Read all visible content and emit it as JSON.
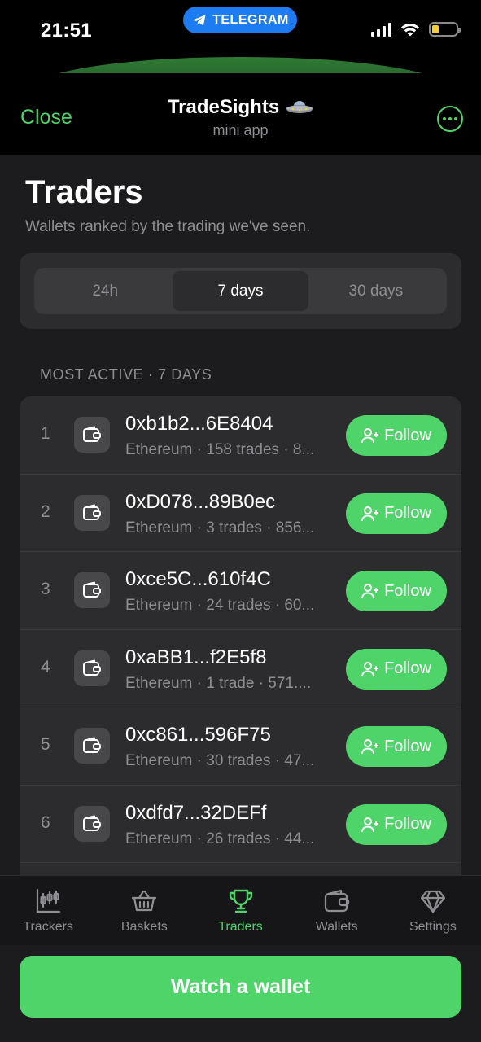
{
  "status_bar": {
    "time": "21:51",
    "telegram_label": "TELEGRAM",
    "battery_level": 0.3
  },
  "header": {
    "close_label": "Close",
    "title": "TradeSights",
    "title_icon": "ufo-icon",
    "subtitle": "mini app"
  },
  "page": {
    "title": "Traders",
    "subtitle": "Wallets ranked by the trading we've seen."
  },
  "period_tabs": {
    "items": [
      "24h",
      "7 days",
      "30 days"
    ],
    "selected": "7 days"
  },
  "section_label": "MOST ACTIVE · 7 DAYS",
  "follow_label": "Follow",
  "traders": [
    {
      "rank": "1",
      "address": "0xb1b2...6E8404",
      "meta": "Ethereum · 158 trades · 8..."
    },
    {
      "rank": "2",
      "address": "0xD078...89B0ec",
      "meta": "Ethereum · 3 trades · 856..."
    },
    {
      "rank": "3",
      "address": "0xce5C...610f4C",
      "meta": "Ethereum · 24 trades · 60..."
    },
    {
      "rank": "4",
      "address": "0xaBB1...f2E5f8",
      "meta": "Ethereum · 1 trade · 571...."
    },
    {
      "rank": "5",
      "address": "0xc861...596F75",
      "meta": "Ethereum · 30 trades · 47..."
    },
    {
      "rank": "6",
      "address": "0xdfd7...32DEFf",
      "meta": "Ethereum · 26 trades · 44..."
    }
  ],
  "tabs": [
    {
      "label": "Trackers",
      "icon": "chart-candles-icon"
    },
    {
      "label": "Baskets",
      "icon": "basket-icon"
    },
    {
      "label": "Traders",
      "icon": "trophy-icon"
    },
    {
      "label": "Wallets",
      "icon": "wallet-icon"
    },
    {
      "label": "Settings",
      "icon": "diamond-icon"
    }
  ],
  "active_tab": "Traders",
  "watch_button_label": "Watch a wallet",
  "colors": {
    "accent": "#4fd46a",
    "telegram_blue": "#1e7cf2",
    "background": "#1c1c1e",
    "card": "#2c2c2e"
  }
}
